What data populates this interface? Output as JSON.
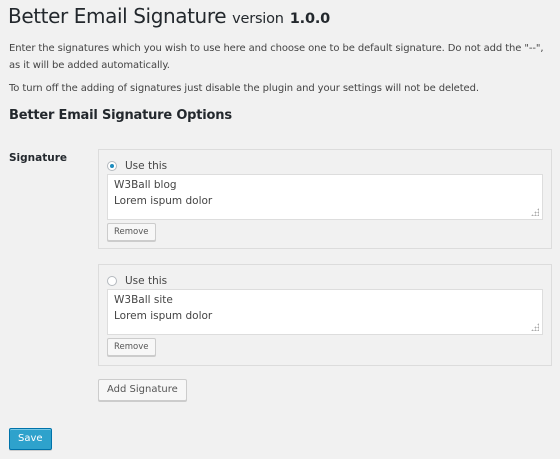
{
  "page": {
    "title": "Better Email Signature",
    "version_word": "version",
    "version_number": "1.0.0",
    "desc1": "Enter the signatures which you wish to use here and choose one to be default signature. Do not add the \"--\", as it will be added automatically.",
    "desc2": "To turn off the adding of signatures just disable the plugin and your settings will not be deleted.",
    "options_title": "Better Email Signature Options",
    "signature_label": "Signature"
  },
  "signatures": [
    {
      "radio_label": "Use this",
      "selected": true,
      "lines": [
        "W3Ball blog",
        "Lorem ispum dolor"
      ],
      "remove_label": "Remove"
    },
    {
      "radio_label": "Use this",
      "selected": false,
      "lines": [
        "W3Ball site",
        "Lorem ispum dolor"
      ],
      "remove_label": "Remove"
    }
  ],
  "buttons": {
    "add_signature": "Add Signature",
    "save": "Save"
  },
  "colors": {
    "background": "#f1f1f1",
    "primary_button": "#2ea2cc",
    "radio_dot": "#1e8cbe"
  }
}
